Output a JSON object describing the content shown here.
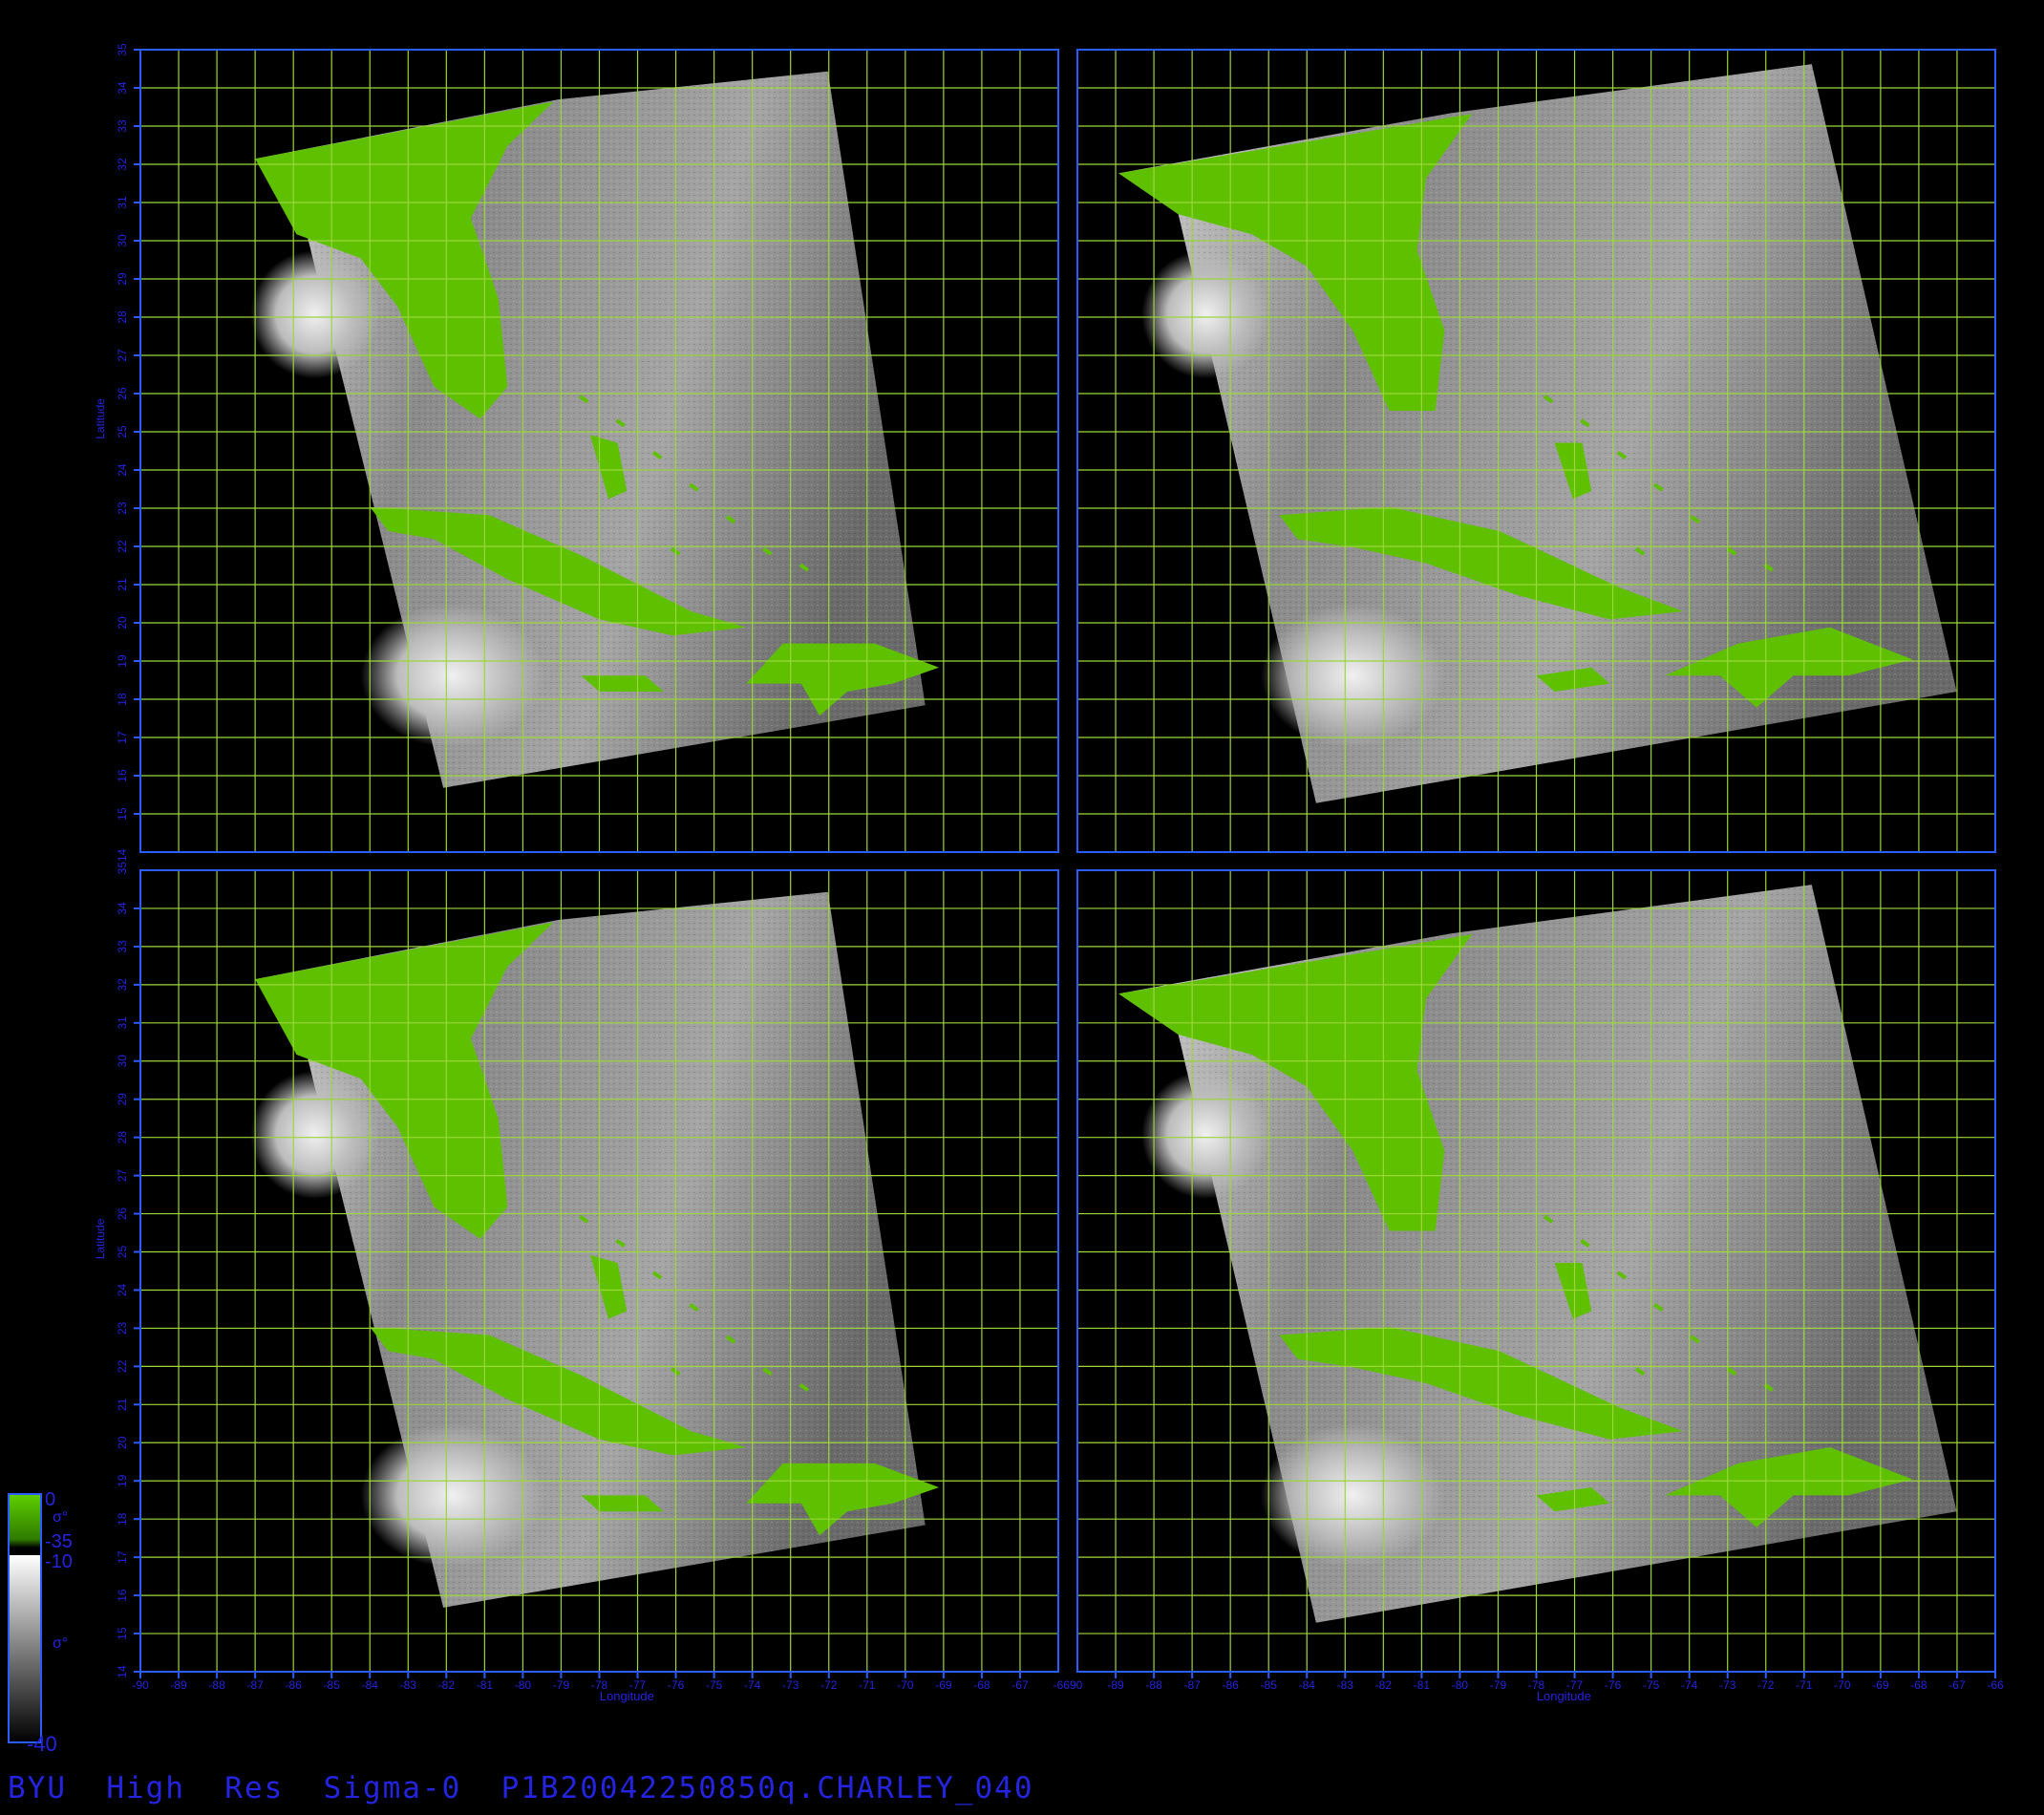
{
  "footer_title": "BYU  High  Res  Sigma-0  P1B20042250850q.CHARLEY_040",
  "axes": {
    "x_label": "Longitude",
    "y_label": "Latitude",
    "lon_ticks_left": [
      "-90",
      "-89",
      "-88",
      "-87",
      "-86",
      "-85",
      "-84",
      "-83",
      "-82",
      "-81",
      "-80",
      "-79",
      "-78",
      "-77",
      "-76",
      "-75",
      "-74",
      "-73",
      "-72",
      "-71",
      "-70",
      "-69",
      "-68",
      "-67",
      "-66"
    ],
    "lon_ticks_right": [
      "-89",
      "-88",
      "-87",
      "-86",
      "-85",
      "-84",
      "-83",
      "-82",
      "-81",
      "-80",
      "-79",
      "-78",
      "-77",
      "-76",
      "-75",
      "-74",
      "-73",
      "-72",
      "-71",
      "-70",
      "-69",
      "-68",
      "-67",
      "-66"
    ],
    "lon_tick_join": "-6690",
    "lat_ticks_top": [
      "15",
      "16",
      "17",
      "18",
      "19",
      "20",
      "21",
      "22",
      "23",
      "24",
      "25",
      "26",
      "27",
      "28",
      "29",
      "30",
      "31",
      "32",
      "33",
      "34",
      "35"
    ],
    "lat_ticks_bottom": [
      "14",
      "15",
      "16",
      "17",
      "18",
      "19",
      "20",
      "21",
      "22",
      "23",
      "24",
      "25",
      "26",
      "27",
      "28",
      "29",
      "30",
      "31",
      "32",
      "33",
      "34"
    ],
    "lat_tick_join": "3514",
    "lon_range": [
      -90,
      -66
    ],
    "lat_range": [
      14,
      35
    ]
  },
  "colorbar": {
    "land_top": "0",
    "land_mid": "σ°",
    "land_bottom": "-35",
    "ocean_top": "-10",
    "ocean_mid": "σ°",
    "ocean_bottom": "-40"
  },
  "colors": {
    "grid": "#9bd63c",
    "frame": "#2a5cff",
    "label": "#2424e0",
    "land": "#5fc000",
    "background": "#000000"
  },
  "panels": [
    "top-left",
    "top-right",
    "bottom-left",
    "bottom-right"
  ]
}
